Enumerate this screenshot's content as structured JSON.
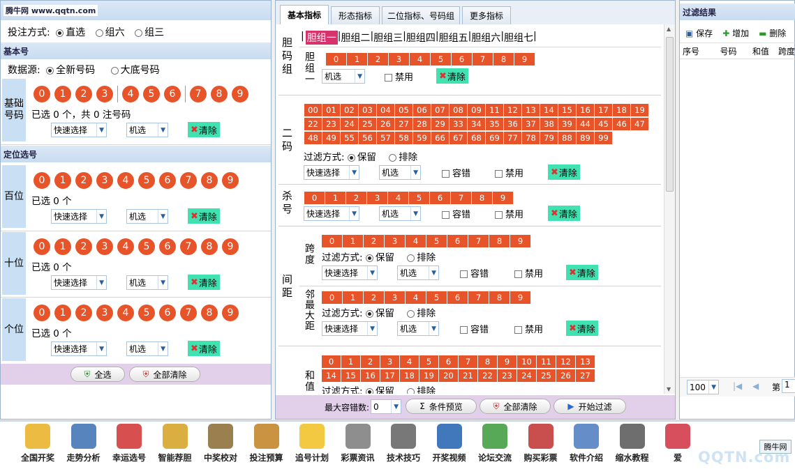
{
  "watermark_top": "腾牛网 www.qqtn.com",
  "left": {
    "bet_mode_label": "投注方式:",
    "bet_modes": [
      "直选",
      "组六",
      "组三"
    ],
    "basic_header": "基本号",
    "source_label": "数据源:",
    "source_options": [
      "全新号码",
      "大底号码"
    ],
    "basic_side": "基础号码",
    "digits": [
      "0",
      "1",
      "2",
      "3",
      "4",
      "5",
      "6",
      "7",
      "8",
      "9"
    ],
    "basic_status": "已选 0 个，共 0 注号码",
    "quick_select": "快速选择",
    "random_select": "机选",
    "clear": "清除",
    "position_header": "定位选号",
    "positions": [
      {
        "label": "百位",
        "status": "已选 0 个"
      },
      {
        "label": "十位",
        "status": "已选 0 个"
      },
      {
        "label": "个位",
        "status": "已选 0 个"
      }
    ],
    "select_all": "全选",
    "clear_all": "全部清除"
  },
  "middle": {
    "tabs": [
      "基本指标",
      "形态指标",
      "二位指标、号码组",
      "更多指标"
    ],
    "dan_side": "胆码组",
    "dan_groups": [
      "胆组一",
      "胆组二",
      "胆组三",
      "胆组四",
      "胆组五",
      "胆组六",
      "胆组七"
    ],
    "dan_row_label": "胆组一",
    "digits": [
      "0",
      "1",
      "2",
      "3",
      "4",
      "5",
      "6",
      "7",
      "8",
      "9"
    ],
    "random_select": "机选",
    "disable": "禁用",
    "clear": "清除",
    "two_code_side": "二码",
    "two_codes": [
      "00",
      "01",
      "02",
      "03",
      "04",
      "05",
      "06",
      "07",
      "08",
      "09",
      "11",
      "12",
      "13",
      "14",
      "15",
      "16",
      "17",
      "18",
      "19",
      "22",
      "23",
      "24",
      "25",
      "26",
      "27",
      "28",
      "29",
      "33",
      "34",
      "35",
      "36",
      "37",
      "38",
      "39",
      "44",
      "45",
      "46",
      "47",
      "48",
      "49",
      "55",
      "56",
      "57",
      "58",
      "59",
      "66",
      "67",
      "68",
      "69",
      "77",
      "78",
      "79",
      "88",
      "89",
      "99"
    ],
    "filter_label": "过滤方式:",
    "keep": "保留",
    "exclude": "排除",
    "quick_select": "快速选择",
    "tolerance": "容错",
    "kill_side": "杀号",
    "gap_side": "间距",
    "span_label": "跨度",
    "adj_label": "邻最大距",
    "sum_label": "和值",
    "sums": [
      "0",
      "1",
      "2",
      "3",
      "4",
      "5",
      "6",
      "7",
      "8",
      "9",
      "10",
      "11",
      "12",
      "13",
      "14",
      "15",
      "16",
      "17",
      "18",
      "19",
      "20",
      "21",
      "22",
      "23",
      "24",
      "25",
      "26",
      "27"
    ],
    "bottom": {
      "max_tol_label": "最大容错数:",
      "max_tol_value": "0",
      "preview": "条件预览",
      "clear_all": "全部清除",
      "start": "开始过滤"
    }
  },
  "right": {
    "title": "过滤结果",
    "save": "保存",
    "add": "增加",
    "delete": "删除",
    "cols": [
      "序号",
      "号码",
      "和值",
      "跨度"
    ],
    "page_size": "100",
    "page_label": "第",
    "page_value": "1"
  },
  "toolbar": [
    "全国开奖",
    "走势分析",
    "幸运选号",
    "智能荐胆",
    "中奖校对",
    "投注预算",
    "追号计划",
    "彩票资讯",
    "技术技巧",
    "开奖视频",
    "论坛交流",
    "购买彩票",
    "软件介绍",
    "缩水教程",
    "爱"
  ],
  "watermark_bottom": "QQTN.com",
  "watermark_badge": "腾牛网",
  "colors": {
    "ball": "#e8542a",
    "side": "#c9dff4",
    "clear": "#3fe2b0",
    "purple_bar": "#e2cfe9"
  }
}
